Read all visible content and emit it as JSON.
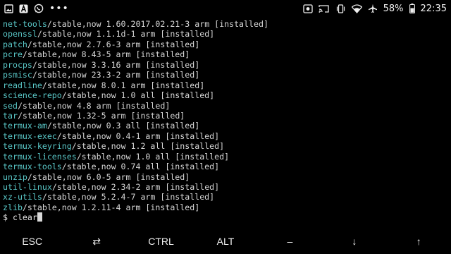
{
  "status_bar": {
    "left_icons": [
      "image-notification-icon",
      "a-notification-icon",
      "whatsapp-icon",
      "more-notifications-icon"
    ],
    "more_dots": "•••",
    "right_icons": [
      "photo-icon",
      "cast-icon",
      "vibrate-icon",
      "wifi-icon",
      "airplane-icon"
    ],
    "battery": "58%",
    "time": "22:35"
  },
  "terminal": {
    "lines": [
      {
        "pkg": "net-tools",
        "rest": "/stable,now 1.60.2017.02.21-3 arm [installed]"
      },
      {
        "pkg": "openssl",
        "rest": "/stable,now 1.1.1d-1 arm [installed]"
      },
      {
        "pkg": "patch",
        "rest": "/stable,now 2.7.6-3 arm [installed]"
      },
      {
        "pkg": "pcre",
        "rest": "/stable,now 8.43-5 arm [installed]"
      },
      {
        "pkg": "procps",
        "rest": "/stable,now 3.3.16 arm [installed]"
      },
      {
        "pkg": "psmisc",
        "rest": "/stable,now 23.3-2 arm [installed]"
      },
      {
        "pkg": "readline",
        "rest": "/stable,now 8.0.1 arm [installed]"
      },
      {
        "pkg": "science-repo",
        "rest": "/stable,now 1.0 all [installed]"
      },
      {
        "pkg": "sed",
        "rest": "/stable,now 4.8 arm [installed]"
      },
      {
        "pkg": "tar",
        "rest": "/stable,now 1.32-5 arm [installed]"
      },
      {
        "pkg": "termux-am",
        "rest": "/stable,now 0.3 all [installed]"
      },
      {
        "pkg": "termux-exec",
        "rest": "/stable,now 0.4-1 arm [installed]"
      },
      {
        "pkg": "termux-keyring",
        "rest": "/stable,now 1.2 all [installed]"
      },
      {
        "pkg": "termux-licenses",
        "rest": "/stable,now 1.0 all [installed]"
      },
      {
        "pkg": "termux-tools",
        "rest": "/stable,now 0.74 all [installed]"
      },
      {
        "pkg": "unzip",
        "rest": "/stable,now 6.0-5 arm [installed]"
      },
      {
        "pkg": "util-linux",
        "rest": "/stable,now 2.34-2 arm [installed]"
      },
      {
        "pkg": "xz-utils",
        "rest": "/stable,now 5.2.4-7 arm [installed]"
      },
      {
        "pkg": "zlib",
        "rest": "/stable,now 1.2.11-4 arm [installed]"
      }
    ],
    "prompt": "$ ",
    "command": "clear"
  },
  "extra_keys": {
    "esc": "ESC",
    "tab": "⇄",
    "ctrl": "CTRL",
    "alt": "ALT",
    "dash": "–",
    "down": "↓",
    "up": "↑"
  },
  "colors": {
    "background": "#000000",
    "package_name": "#5ac8c8",
    "text": "#d8d8d8"
  }
}
